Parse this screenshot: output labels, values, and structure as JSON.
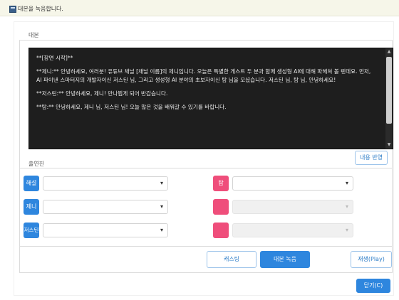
{
  "window": {
    "title": "대본을 녹음합니다."
  },
  "script": {
    "section_label": "대본",
    "lines": [
      "**[장면 시작]**",
      "**제니:** 안녕하세요, 여러분! 유튜브 채널 [채널 이름]의 제니입니다. 오늘은 특별한 게스트 두 분과 함께 생성형 AI에 대해 파헤쳐 볼 텐데요. 먼저, AI 파이낸 스마터지의 개발자이신 저스틴 님, 그리고 생성형 AI 분야의 초보자이신 탐 님을 모셨습니다. 저스틴 님, 탐 님, 안녕하세요!",
      "**저스틴:** 안녕하세요, 제니! 만나뵙게 되어 반갑습니다.",
      "**탐:** 안녕하세요, 제니 님, 저스틴 님! 오늘 많은 것을 배워갈 수 있기를 바랍니다."
    ],
    "apply_button": "내용 반영"
  },
  "cast": {
    "section_label": "출연진",
    "left_roles": [
      {
        "label": "해설",
        "value": ""
      },
      {
        "label": "제니",
        "value": ""
      },
      {
        "label": "저스틴",
        "value": ""
      }
    ],
    "right_roles": [
      {
        "label": "탐",
        "value": "",
        "enabled": true
      },
      {
        "label": "",
        "value": "",
        "enabled": false
      },
      {
        "label": "",
        "value": "",
        "enabled": false
      }
    ]
  },
  "actions": {
    "casting": "캐스팅",
    "record": "대본 녹음",
    "play": "재생(Play)",
    "close": "닫기(C)"
  },
  "colors": {
    "accent": "#2e86de",
    "pink": "#ef4e7b",
    "script_bg": "#1e1e1e"
  }
}
